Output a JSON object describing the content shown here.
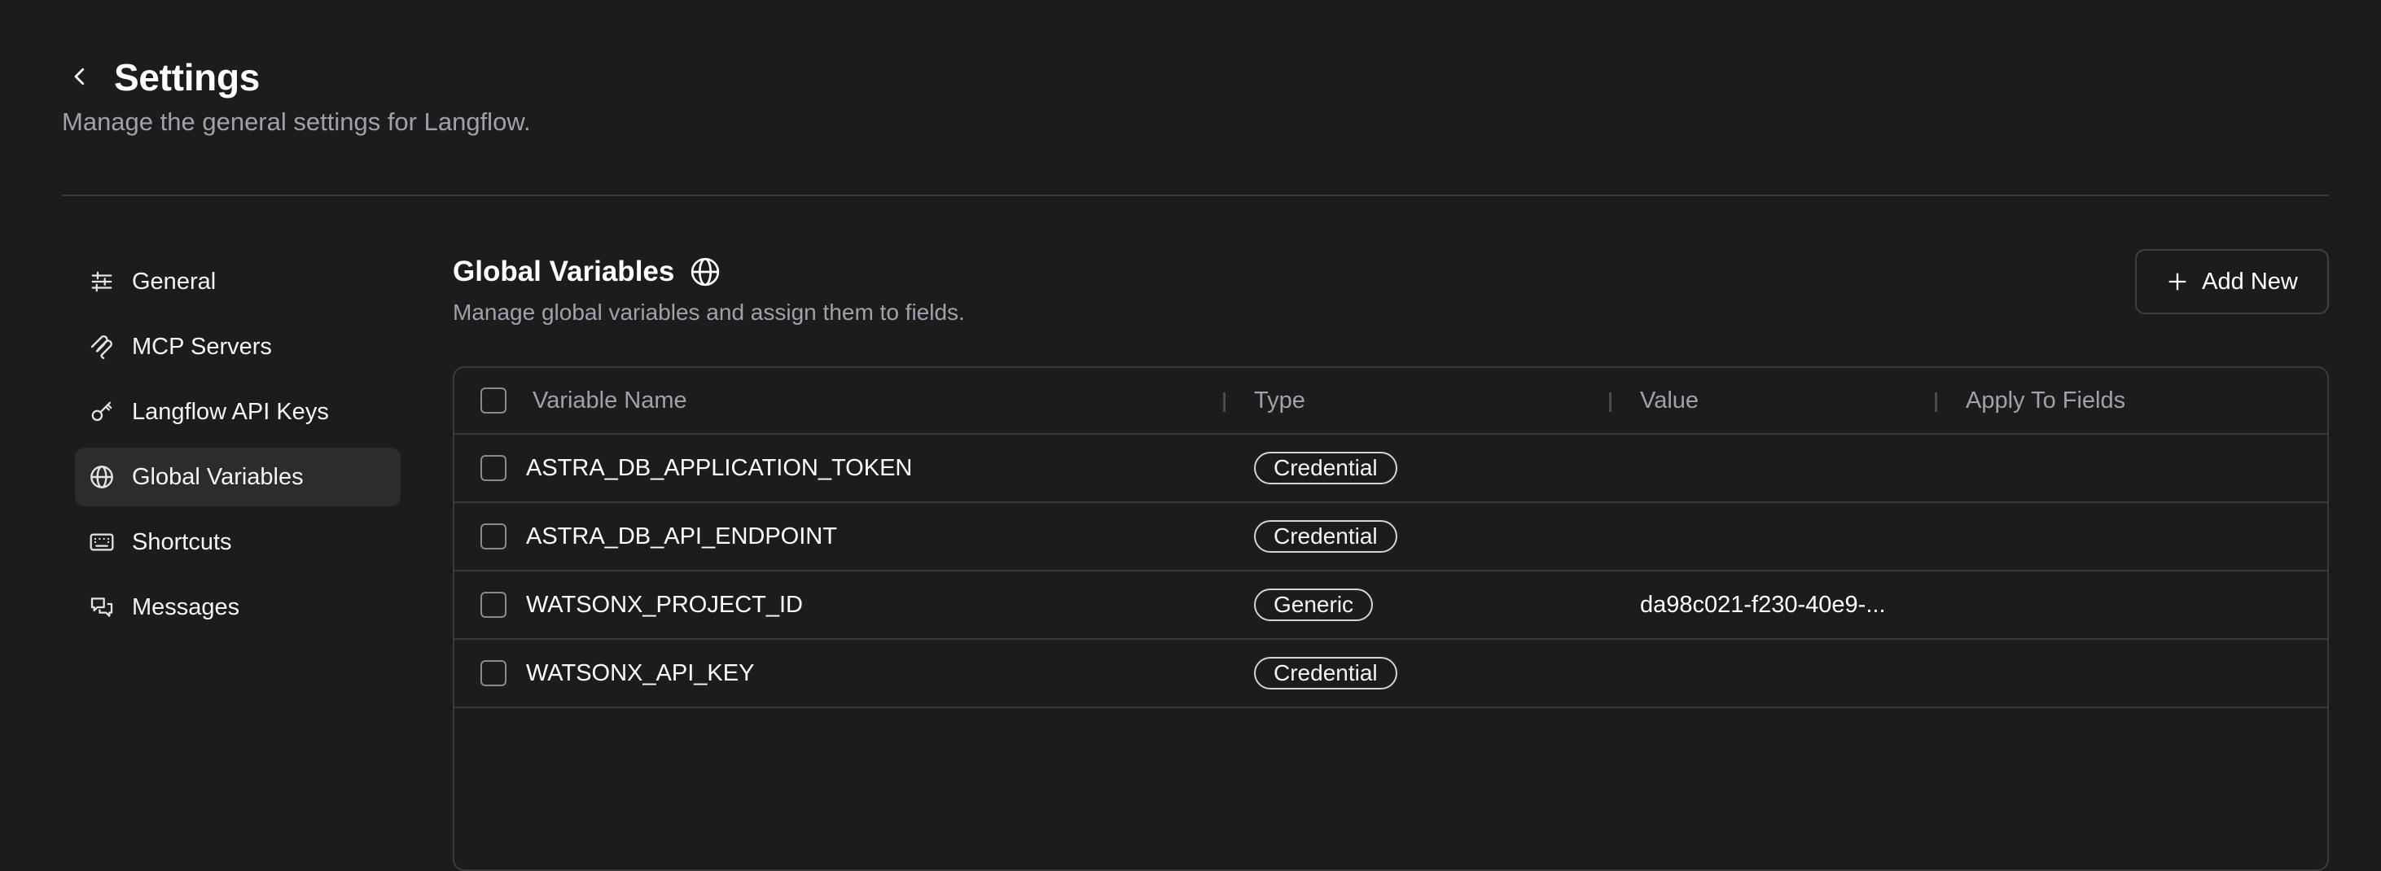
{
  "header": {
    "title": "Settings",
    "subtitle": "Manage the general settings for Langflow."
  },
  "sidebar": {
    "items": [
      {
        "label": "General",
        "icon": "sliders-icon",
        "active": false
      },
      {
        "label": "MCP Servers",
        "icon": "mcp-icon",
        "active": false
      },
      {
        "label": "Langflow API Keys",
        "icon": "key-icon",
        "active": false
      },
      {
        "label": "Global Variables",
        "icon": "globe-icon",
        "active": true
      },
      {
        "label": "Shortcuts",
        "icon": "keyboard-icon",
        "active": false
      },
      {
        "label": "Messages",
        "icon": "messages-icon",
        "active": false
      }
    ]
  },
  "main": {
    "title": "Global Variables",
    "description": "Manage global variables and assign them to fields.",
    "add_button_label": "Add New"
  },
  "table": {
    "columns": [
      "Variable Name",
      "Type",
      "Value",
      "Apply To Fields"
    ],
    "rows": [
      {
        "name": "ASTRA_DB_APPLICATION_TOKEN",
        "type": "Credential",
        "value": "",
        "fields": ""
      },
      {
        "name": "ASTRA_DB_API_ENDPOINT",
        "type": "Credential",
        "value": "",
        "fields": ""
      },
      {
        "name": "WATSONX_PROJECT_ID",
        "type": "Generic",
        "value": "da98c021-f230-40e9-...",
        "fields": ""
      },
      {
        "name": "WATSONX_API_KEY",
        "type": "Credential",
        "value": "",
        "fields": ""
      }
    ]
  }
}
